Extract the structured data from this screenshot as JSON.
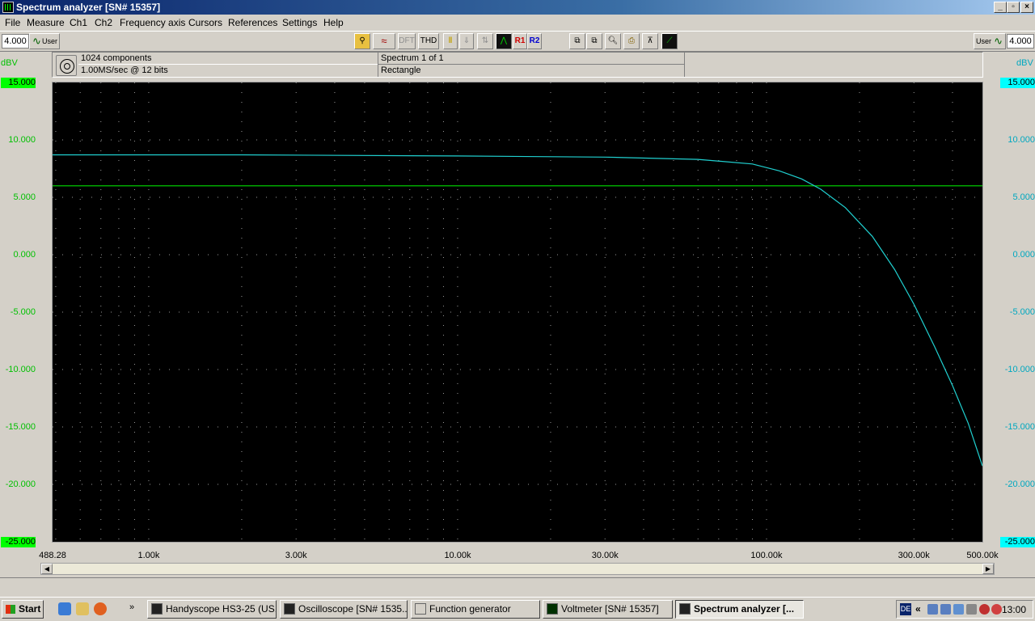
{
  "window": {
    "title": "Spectrum analyzer  [SN# 15357]"
  },
  "menu": [
    "File",
    "Measure",
    "Ch1",
    "Ch2",
    "Frequency axis",
    "Cursors",
    "References",
    "Settings",
    "Help"
  ],
  "toolbar": {
    "left_value": "4.000",
    "left_mode": "User",
    "right_value": "4.000",
    "right_mode": "User",
    "dft_label": "DFT",
    "thd_label": "THD",
    "r1_label": "R1",
    "r2_label": "R2"
  },
  "info": {
    "components": "1024 components",
    "sample_rate": "1.00MS/sec @ 12 bits",
    "spectrum": "Spectrum 1 of 1",
    "window_fn": "Rectangle"
  },
  "axis": {
    "left_unit": "dBV",
    "right_unit": "dBV"
  },
  "colors": {
    "ch1": "#00e000",
    "ch2": "#20d0d0",
    "plot_bg": "#000000"
  },
  "chart_data": {
    "type": "line",
    "xscale": "log",
    "xlim": [
      488.28,
      500000
    ],
    "ylim": [
      -25,
      15
    ],
    "grid": true,
    "xticks": [
      {
        "v": 488.28,
        "label": "488.28"
      },
      {
        "v": 1000,
        "label": "1.00k"
      },
      {
        "v": 3000,
        "label": "3.00k"
      },
      {
        "v": 10000,
        "label": "10.00k"
      },
      {
        "v": 30000,
        "label": "30.00k"
      },
      {
        "v": 100000,
        "label": "100.00k"
      },
      {
        "v": 300000,
        "label": "300.00k"
      },
      {
        "v": 500000,
        "label": "500.00k"
      }
    ],
    "yticks": [
      {
        "v": 15,
        "label": "15.000"
      },
      {
        "v": 10,
        "label": "10.000"
      },
      {
        "v": 5,
        "label": "5.000"
      },
      {
        "v": 0,
        "label": "0.000"
      },
      {
        "v": -5,
        "label": "-5.000"
      },
      {
        "v": -10,
        "label": "-10.000"
      },
      {
        "v": -15,
        "label": "-15.000"
      },
      {
        "v": -20,
        "label": "-20.000"
      },
      {
        "v": -25,
        "label": "-25.000"
      }
    ],
    "series": [
      {
        "color": "#00e000",
        "x": [
          488.28,
          5000,
          20000,
          100000,
          500000
        ],
        "y": [
          6.0,
          6.0,
          6.0,
          6.0,
          6.0
        ]
      },
      {
        "color": "#20d0d0",
        "x": [
          488.28,
          2000,
          10000,
          30000,
          60000,
          90000,
          110000,
          130000,
          150000,
          180000,
          220000,
          260000,
          300000,
          350000,
          400000,
          450000,
          500000
        ],
        "y": [
          8.7,
          8.7,
          8.6,
          8.5,
          8.3,
          7.9,
          7.3,
          6.6,
          5.7,
          4.1,
          1.6,
          -1.3,
          -4.3,
          -8.0,
          -11.4,
          -14.7,
          -18.4
        ]
      }
    ]
  },
  "taskbar": {
    "start": "Start",
    "tasks": [
      "Handyscope HS3-25 (US...",
      "Oscilloscope  [SN# 1535...",
      "Function generator",
      "Voltmeter  [SN# 15357]",
      "Spectrum analyzer  [..."
    ],
    "lang": "DE",
    "clock": "13:00"
  }
}
